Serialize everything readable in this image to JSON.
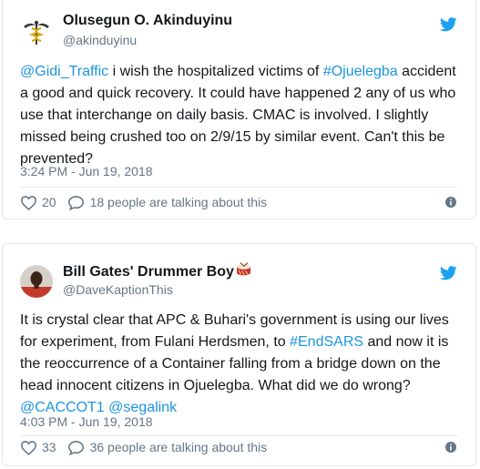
{
  "tweets": [
    {
      "name": "Olusegun O. Akinduyinu",
      "handle": "@akinduyinu",
      "text": [
        {
          "t": "@Gidi_Traffic",
          "link": true
        },
        {
          "t": " i wish the hospitalized victims of  ",
          "link": false
        },
        {
          "t": "#Ojuelegba",
          "link": true
        },
        {
          "t": " accident a good and quick recovery. It could have happened 2 any of us who use that interchange on daily basis. CMAC is involved. I slightly missed being crushed too on 2/9/15 by similar event. Can't this be prevented?",
          "link": false
        }
      ],
      "time": "3:24 PM - Jun 19, 2018",
      "likes": "20",
      "talking": "18 people are talking about this",
      "icons": {
        "brand": "twitter-bird-icon",
        "like": "heart-icon",
        "reply": "speech-bubble-icon",
        "info": "info-icon"
      }
    },
    {
      "name": "Bill Gates' Drummer Boy",
      "name_emoji": "drum-emoji",
      "handle": "@DaveKaptionThis",
      "text": [
        {
          "t": "It is crystal clear that APC & Buhari's government is using our lives for experiment, from Fulani Herdsmen, to ",
          "link": false
        },
        {
          "t": "#EndSARS",
          "link": true
        },
        {
          "t": " and now it is the reoccurrence of a Container falling from a bridge down on the head innocent citizens in Ojuelegba. What did we do wrong? ",
          "link": false
        },
        {
          "t": "@CACCOT1",
          "link": true
        },
        {
          "t": " ",
          "link": false
        },
        {
          "t": "@segalink",
          "link": true
        }
      ],
      "time": "4:03 PM - Jun 19, 2018",
      "likes": "33",
      "talking": "36 people are talking about this",
      "icons": {
        "brand": "twitter-bird-icon",
        "like": "heart-icon",
        "reply": "speech-bubble-icon",
        "info": "info-icon"
      }
    }
  ],
  "colors": {
    "link": "#1b95e0",
    "brand": "#1da1f2",
    "muted": "#657786",
    "text": "#14171a",
    "border": "#e1e8ed"
  }
}
